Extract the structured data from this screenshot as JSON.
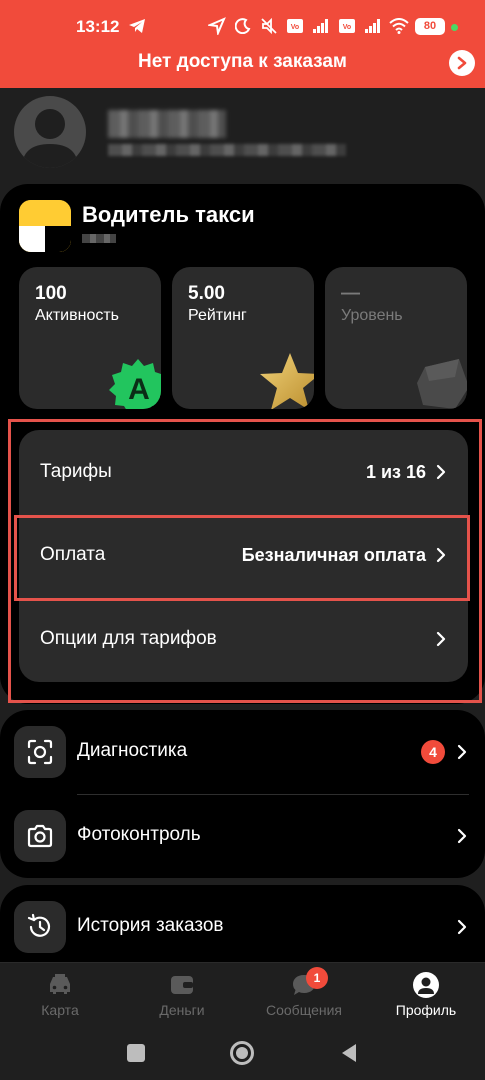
{
  "status_bar": {
    "time": "13:12",
    "battery": "80"
  },
  "banner": {
    "text": "Нет доступа к заказам"
  },
  "role": {
    "title": "Водитель такси"
  },
  "stats": [
    {
      "value": "100",
      "label": "Активность"
    },
    {
      "value": "5.00",
      "label": "Рейтинг"
    },
    {
      "value": "—",
      "label": "Уровень"
    }
  ],
  "settings": {
    "tariffs_label": "Тарифы",
    "tariffs_value": "1 из 16",
    "payment_label": "Оплата",
    "payment_value": "Безналичная оплата",
    "options_label": "Опции для тарифов"
  },
  "menu": {
    "diagnostics_label": "Диагностика",
    "diagnostics_badge": "4",
    "photocontrol_label": "Фотоконтроль",
    "history_label": "История заказов"
  },
  "tabs": {
    "map": "Карта",
    "money": "Деньги",
    "messages": "Сообщения",
    "messages_badge": "1",
    "profile": "Профиль"
  },
  "colors": {
    "accent_red": "#f14b3b",
    "brand_yellow": "#fc3",
    "highlight_outline": "#e5534b"
  }
}
